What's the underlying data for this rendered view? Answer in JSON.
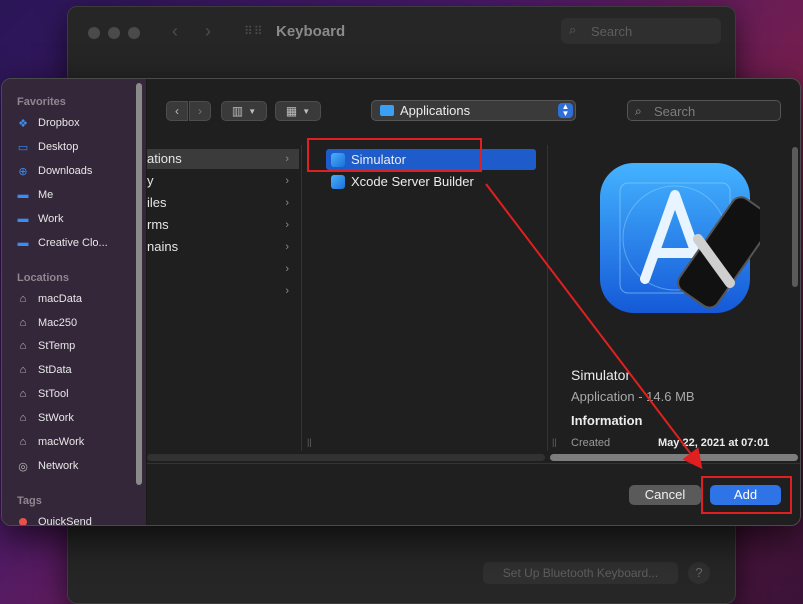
{
  "background_window": {
    "title": "Keyboard",
    "search_placeholder": "Search",
    "bluetooth_button": "Set Up Bluetooth Keyboard...",
    "help_button": "?"
  },
  "sidebar": {
    "favorites_header": "Favorites",
    "favorites": [
      {
        "label": "Dropbox",
        "icon": "dropbox-icon"
      },
      {
        "label": "Desktop",
        "icon": "desktop-icon"
      },
      {
        "label": "Downloads",
        "icon": "downloads-icon"
      },
      {
        "label": "Me",
        "icon": "folder-icon"
      },
      {
        "label": "Work",
        "icon": "folder-icon"
      },
      {
        "label": "Creative Clo...",
        "icon": "folder-icon"
      }
    ],
    "locations_header": "Locations",
    "locations": [
      {
        "label": "macData",
        "icon": "drive-icon"
      },
      {
        "label": "Mac250",
        "icon": "drive-icon"
      },
      {
        "label": "StTemp",
        "icon": "drive-icon"
      },
      {
        "label": "StData",
        "icon": "drive-icon"
      },
      {
        "label": "StTool",
        "icon": "drive-icon"
      },
      {
        "label": "StWork",
        "icon": "drive-icon"
      },
      {
        "label": "macWork",
        "icon": "drive-icon"
      },
      {
        "label": "Network",
        "icon": "network-icon"
      }
    ],
    "tags_header": "Tags",
    "tags": [
      {
        "label": "QuickSend",
        "color": "#e5534b"
      }
    ]
  },
  "toolbar": {
    "location": "Applications",
    "search_placeholder": "Search"
  },
  "column1": {
    "items": [
      "ations",
      "y",
      "iles",
      "rms",
      "nains",
      "",
      ""
    ]
  },
  "column2": {
    "items": [
      {
        "label": "Simulator",
        "selected": true
      },
      {
        "label": "Xcode Server Builder",
        "selected": false
      }
    ]
  },
  "preview": {
    "name": "Simulator",
    "kind": "Application - 14.6 MB",
    "info_header": "Information",
    "created_label": "Created",
    "created_value": "May 22, 2021 at 07:01"
  },
  "buttons": {
    "cancel": "Cancel",
    "add": "Add"
  },
  "colors": {
    "accent": "#2f74e6",
    "selection": "#1e5ccc",
    "annotation": "#e02020"
  }
}
